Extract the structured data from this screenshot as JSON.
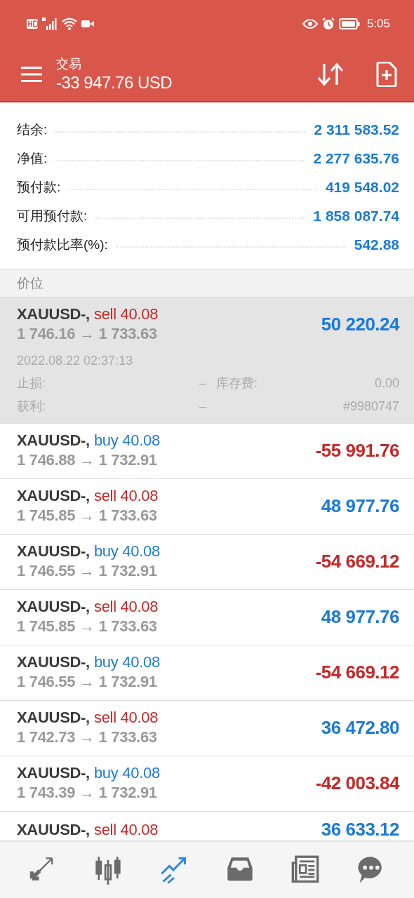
{
  "status_bar": {
    "time": "5:05"
  },
  "toolbar": {
    "title": "交易",
    "subtitle": "-33 947.76 USD"
  },
  "summary": [
    {
      "label": "结余:",
      "value": "2 311 583.52"
    },
    {
      "label": "净值:",
      "value": "2 277 635.76"
    },
    {
      "label": "预付款:",
      "value": "419 548.02"
    },
    {
      "label": "可用预付款:",
      "value": "1 858 087.74"
    },
    {
      "label": "预付款比率(%):",
      "value": "542.88"
    }
  ],
  "section_header": "价位",
  "positions": [
    {
      "symbol": "XAUUSD-,",
      "side": "sell",
      "volume": "40.08",
      "prices": "1 746.16 → 1 733.63",
      "profit": "50 220.24",
      "kind": "gain",
      "expanded": true,
      "time": "2022.08.22 02:37:13",
      "sl_label": "止损:",
      "sl_value": "–",
      "swap_label": "库存费:",
      "swap_value": "0.00",
      "tp_label": "获利:",
      "tp_value": "–",
      "ticket": "#9980747"
    },
    {
      "symbol": "XAUUSD-,",
      "side": "buy",
      "volume": "40.08",
      "prices": "1 746.88 → 1 732.91",
      "profit": "-55 991.76",
      "kind": "loss",
      "expanded": false
    },
    {
      "symbol": "XAUUSD-,",
      "side": "sell",
      "volume": "40.08",
      "prices": "1 745.85 → 1 733.63",
      "profit": "48 977.76",
      "kind": "gain",
      "expanded": false
    },
    {
      "symbol": "XAUUSD-,",
      "side": "buy",
      "volume": "40.08",
      "prices": "1 746.55 → 1 732.91",
      "profit": "-54 669.12",
      "kind": "loss",
      "expanded": false
    },
    {
      "symbol": "XAUUSD-,",
      "side": "sell",
      "volume": "40.08",
      "prices": "1 745.85 → 1 733.63",
      "profit": "48 977.76",
      "kind": "gain",
      "expanded": false
    },
    {
      "symbol": "XAUUSD-,",
      "side": "buy",
      "volume": "40.08",
      "prices": "1 746.55 → 1 732.91",
      "profit": "-54 669.12",
      "kind": "loss",
      "expanded": false
    },
    {
      "symbol": "XAUUSD-,",
      "side": "sell",
      "volume": "40.08",
      "prices": "1 742.73 → 1 733.63",
      "profit": "36 472.80",
      "kind": "gain",
      "expanded": false
    },
    {
      "symbol": "XAUUSD-,",
      "side": "buy",
      "volume": "40.08",
      "prices": "1 743.39 → 1 732.91",
      "profit": "-42 003.84",
      "kind": "loss",
      "expanded": false
    },
    {
      "symbol": "XAUUSD-,",
      "side": "sell",
      "volume": "40.08",
      "profit": "36 633.12",
      "kind": "gain",
      "expanded": false
    }
  ],
  "bottom_nav": [
    {
      "kind": "quotes",
      "selected": false
    },
    {
      "kind": "chart",
      "selected": false
    },
    {
      "kind": "trade",
      "selected": true
    },
    {
      "kind": "history",
      "selected": false
    },
    {
      "kind": "news",
      "selected": false
    },
    {
      "kind": "chat",
      "selected": false
    }
  ]
}
